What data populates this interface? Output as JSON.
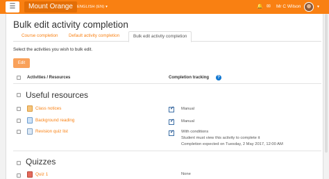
{
  "navbar": {
    "menu_icon": "hamburger-menu-icon",
    "brand": "Mount Orange",
    "language": "ENGLISH (EN) ▾",
    "notification_icon": "bell-icon",
    "messages_icon": "chat-bubble-icon",
    "user_name": "Mr C Wilson",
    "brand_color": "#f98012"
  },
  "page": {
    "title": "Bulk edit activity completion",
    "tabs": [
      {
        "label": "Course completion",
        "active": false
      },
      {
        "label": "Default activity completion",
        "active": false
      },
      {
        "label": "Bulk edit activity completion",
        "active": true
      }
    ],
    "intro": "Select the activities you wish to bulk edit.",
    "edit_button": "Edit",
    "columns": {
      "activities": "Activities / Resources",
      "completion": "Completion tracking",
      "help_icon": "question-circle-icon"
    }
  },
  "sections": [
    {
      "title": "Useful resources",
      "activities": [
        {
          "name": "Class notices",
          "icon": "forum-icon",
          "tracked": true,
          "completion": [
            "Manual"
          ]
        },
        {
          "name": "Background reading",
          "icon": "url-link-icon",
          "tracked": true,
          "completion": [
            "Manual"
          ]
        },
        {
          "name": "Revision quiz list",
          "icon": "file-icon",
          "tracked": true,
          "completion": [
            "With conditions",
            "Student must view this activity to complete it",
            "Completion expected on Tuesday, 2 May 2017, 12:00 AM"
          ]
        }
      ]
    },
    {
      "title": "Quizzes",
      "activities": [
        {
          "name": "Quiz 1",
          "icon": "quiz-icon",
          "tracked": false,
          "completion": [
            "None"
          ]
        }
      ]
    }
  ]
}
